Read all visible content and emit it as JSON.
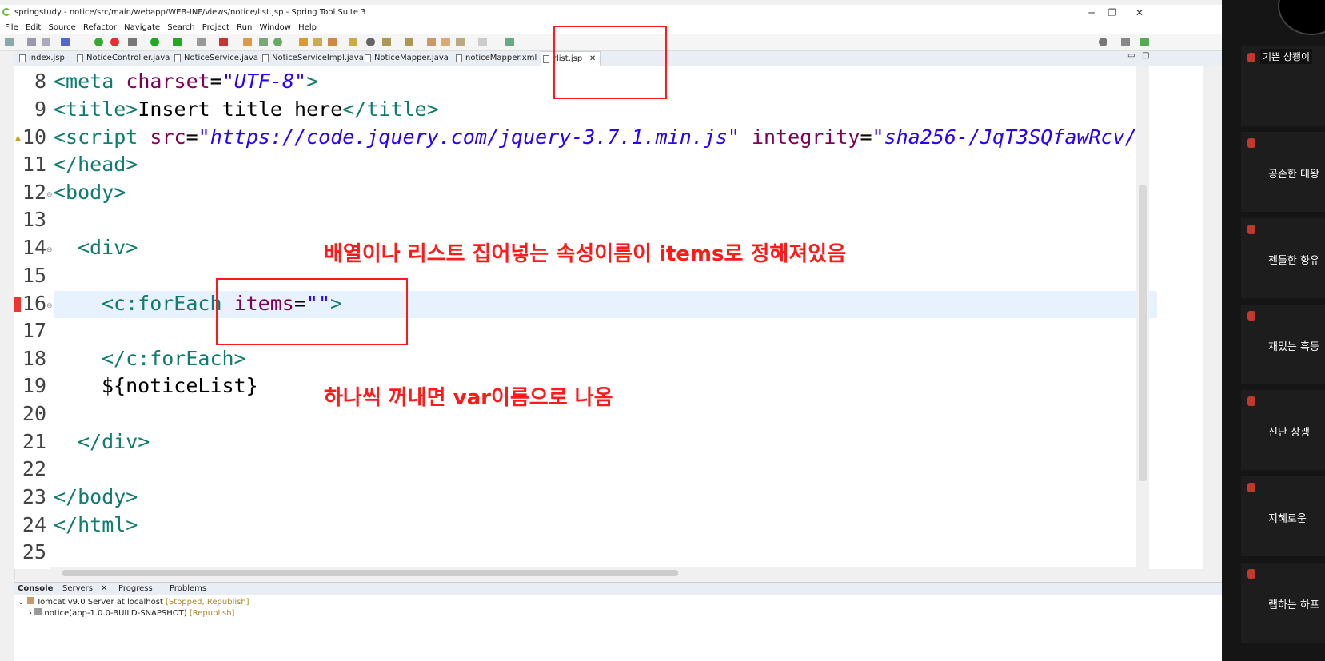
{
  "window": {
    "title": "springstudy - notice/src/main/webapp/WEB-INF/views/notice/list.jsp - Spring Tool Suite 3",
    "minimize": "─",
    "restore": "❐",
    "close": "✕"
  },
  "menu": [
    "File",
    "Edit",
    "Source",
    "Refactor",
    "Navigate",
    "Search",
    "Project",
    "Run",
    "Window",
    "Help"
  ],
  "tabs": [
    {
      "label": "index.jsp"
    },
    {
      "label": "NoticeController.java"
    },
    {
      "label": "NoticeService.java"
    },
    {
      "label": "NoticeServiceImpl.java"
    },
    {
      "label": "NoticeMapper.java"
    },
    {
      "label": "noticeMapper.xml"
    },
    {
      "label": "*list.jsp",
      "close": "✕"
    }
  ],
  "editor": {
    "lines": [
      {
        "n": "8"
      },
      {
        "n": "9"
      },
      {
        "n": "10"
      },
      {
        "n": "11"
      },
      {
        "n": "12"
      },
      {
        "n": "13"
      },
      {
        "n": "14"
      },
      {
        "n": "15"
      },
      {
        "n": "16"
      },
      {
        "n": "17"
      },
      {
        "n": "18"
      },
      {
        "n": "19"
      },
      {
        "n": "20"
      },
      {
        "n": "21"
      },
      {
        "n": "22"
      },
      {
        "n": "23"
      },
      {
        "n": "24"
      },
      {
        "n": "25"
      }
    ],
    "code": {
      "l8": {
        "open": "<meta ",
        "attr": "charset",
        "eq": "=",
        "val": "\"UTF-8\"",
        "close": ">"
      },
      "l9": {
        "open": "<title>",
        "text": "Insert title here",
        "close": "</title>"
      },
      "l10": {
        "open": "<script ",
        "attr": "src",
        "eq": "=",
        "val": "\"https://code.jquery.com/jquery-3.7.1.min.js\"",
        "attr2": " integrity",
        "eq2": "=",
        "val2": "\"sha256-/JqT3SQfawRcv/"
      },
      "l11": {
        "text": "</head>"
      },
      "l12": {
        "text": "<body>"
      },
      "l14": {
        "text": "<div>"
      },
      "l16": {
        "open": "<c:forEach ",
        "attr": "items",
        "eq": "=",
        "val": "\"\"",
        "close": ">"
      },
      "l18": {
        "text": "</c:forEach>"
      },
      "l19": {
        "text": "${noticeList}"
      },
      "l21": {
        "text": "</div>"
      },
      "l23": {
        "text": "</body>"
      },
      "l24": {
        "text": "</html>"
      }
    }
  },
  "annotations": {
    "note1": "배열이나 리스트 집어넣는 속성이름이 items로 정해져있음",
    "note2": "하나씩 꺼내면 var이름으로 나옴"
  },
  "console": {
    "tabs": [
      "Console",
      "Servers",
      "Progress",
      "Problems"
    ],
    "servers_close": "✕",
    "server": "Tomcat v9.0 Server at localhost",
    "server_status": "[Stopped, Republish]",
    "module": "notice(app-1.0.0-BUILD-SNAPSHOT)",
    "module_status": "[Republish]"
  },
  "participants": [
    {
      "name": "기쁜 상쾡이",
      "is_label": true
    },
    {
      "name": "공손한 대왕"
    },
    {
      "name": "젠틀한 향유"
    },
    {
      "name": "재밌는 흑등"
    },
    {
      "name": "신난 상괭"
    },
    {
      "name": "지혜로운"
    },
    {
      "name": "랩하는 하프"
    }
  ],
  "colors": {
    "annotation": "#ff1a1a",
    "tag": "#117b6f",
    "attr": "#7f0055",
    "string": "#2a00ff"
  }
}
